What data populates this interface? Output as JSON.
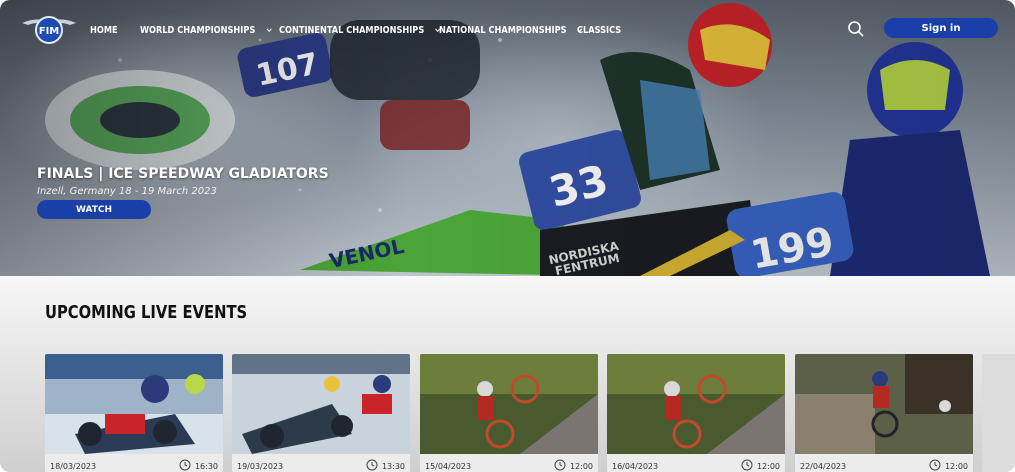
{
  "nav": {
    "items": [
      {
        "label": "HOME",
        "has_dropdown": false
      },
      {
        "label": "WORLD CHAMPIONSHIPS",
        "has_dropdown": true
      },
      {
        "label": "CONTINENTAL CHAMPIONSHIPS",
        "has_dropdown": true
      },
      {
        "label": "NATIONAL CHAMPIONSHIPS",
        "has_dropdown": true
      },
      {
        "label": "CLASSICS",
        "has_dropdown": false
      }
    ],
    "logo_text": "FIM",
    "sign_in_label": "Sign in"
  },
  "hero": {
    "title": "FINALS | ICE SPEEDWAY GLADIATORS",
    "subtitle": "Inzell, Germany 18 - 19 March 2023",
    "watch_label": "WATCH",
    "bike_numbers": [
      "107",
      "33",
      "199"
    ],
    "sponsor_text": [
      "VENOL",
      "NORDISKA FENTRUM"
    ]
  },
  "upcoming": {
    "title": "UPCOMING LIVE EVENTS",
    "events": [
      {
        "date": "18/03/2023",
        "time": "16:30",
        "theme": "ice"
      },
      {
        "date": "19/03/2023",
        "time": "13:30",
        "theme": "ice"
      },
      {
        "date": "15/04/2023",
        "time": "12:00",
        "theme": "trial"
      },
      {
        "date": "16/04/2023",
        "time": "12:00",
        "theme": "trial"
      },
      {
        "date": "22/04/2023",
        "time": "12:00",
        "theme": "trial-stone"
      }
    ]
  },
  "colors": {
    "accent": "#1a3fa8",
    "hero_text": "#ffffff",
    "section_title": "#111111"
  },
  "icons": {
    "search": "search-icon",
    "chevron": "chevron-down-icon",
    "clock": "clock-icon"
  }
}
